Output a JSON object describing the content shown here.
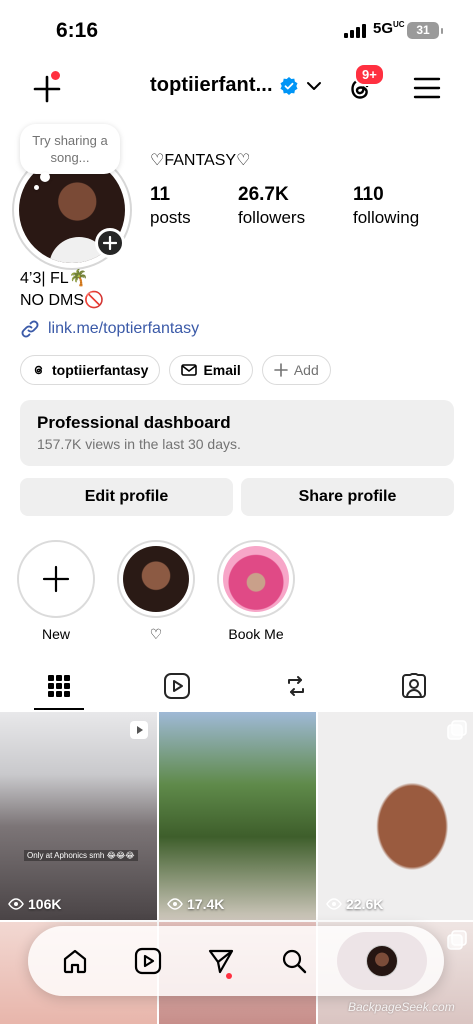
{
  "status_bar": {
    "time": "6:16",
    "network": "5G",
    "network_sup": "UC",
    "battery": "31"
  },
  "header": {
    "username": "toptiierfant...",
    "notification_badge": "9+",
    "accent_color": "#ff3040",
    "verified_color": "#0095f6"
  },
  "profile": {
    "note_placeholder": "Try sharing a song...",
    "display_name": "♡FANTASY♡",
    "stats": [
      {
        "value": "11",
        "label": "posts"
      },
      {
        "value": "26.7K",
        "label": "followers"
      },
      {
        "value": "110",
        "label": "following"
      }
    ],
    "bio_lines": [
      "4’3| FL🌴",
      "NO DMS🚫"
    ],
    "link": "link.me/toptierfantasy",
    "link_color": "#3b5aa8"
  },
  "chips": [
    {
      "label": "toptiierfantasy",
      "icon": "threads-icon"
    },
    {
      "label": "Email",
      "icon": "mail-icon"
    },
    {
      "label": "Add",
      "icon": "plus-icon"
    }
  ],
  "dashboard": {
    "title": "Professional dashboard",
    "subtitle": "157.7K views in the last 30 days."
  },
  "buttons": {
    "edit": "Edit profile",
    "share": "Share profile"
  },
  "highlights": [
    {
      "label": "New"
    },
    {
      "label": "♡"
    },
    {
      "label": "Book Me"
    }
  ],
  "tabs": [
    "grid-icon",
    "reels-icon",
    "reposts-icon",
    "tagged-icon"
  ],
  "posts": [
    {
      "views": "106K",
      "caption": "Only at Aphonics smh 😂😂😂"
    },
    {
      "views": "17.4K"
    },
    {
      "views": "22.6K"
    }
  ],
  "nav": [
    "home-icon",
    "reels-icon",
    "direct-icon",
    "search-icon",
    "profile-avatar"
  ],
  "watermark": "BackpageSeek.com"
}
